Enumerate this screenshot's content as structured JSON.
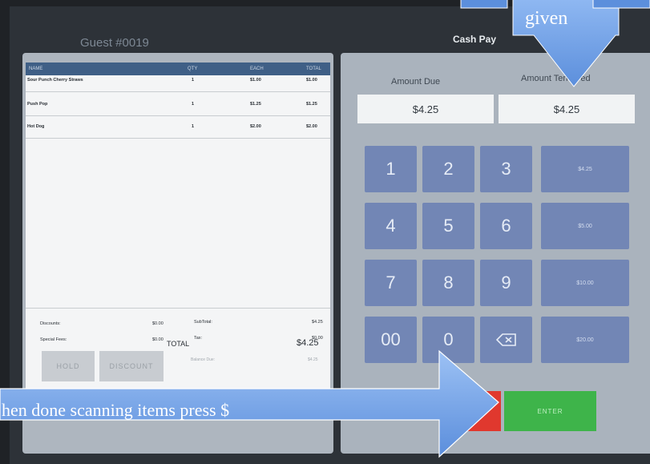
{
  "header": {
    "guest_label": "Guest #0019",
    "screen_title": "Cash Pay"
  },
  "receipt": {
    "columns": [
      "NAME",
      "QTY",
      "EACH",
      "TOTAL"
    ],
    "items": [
      {
        "name": "Sour Punch Cherry Straws",
        "qty": "1",
        "each": "$1.00",
        "total": "$1.00"
      },
      {
        "name": "Push Pop",
        "qty": "1",
        "each": "$1.25",
        "total": "$1.25"
      },
      {
        "name": "Hot Dog",
        "qty": "1",
        "each": "$2.00",
        "total": "$2.00"
      }
    ],
    "discounts_label": "Discounts:",
    "discounts_value": "$0.00",
    "special_fees_label": "Special Fees:",
    "special_fees_value": "$0.00",
    "subtotal_label": "SubTotal:",
    "subtotal_value": "$4.25",
    "tax_label": "Tax:",
    "tax_value": "$0.00",
    "total_label": "TOTAL",
    "total_value": "$4.25",
    "balance_label": "Balance Due:",
    "balance_value": "$4.25",
    "hold_label": "HOLD",
    "discount_label": "DISCOUNT"
  },
  "payment": {
    "amount_due_label": "Amount Due",
    "amount_due_value": "$4.25",
    "amount_tendered_label": "Amount Tendered",
    "amount_tendered_value": "$4.25",
    "keys": [
      "1",
      "2",
      "3",
      "4",
      "5",
      "6",
      "7",
      "8",
      "9",
      "00",
      "0"
    ],
    "backspace_icon": "backspace-icon",
    "quick_amounts": [
      "$4.25",
      "$5.00",
      "$10.00",
      "$20.00"
    ],
    "enter_label": "ENTER"
  },
  "callouts": {
    "top_text": "given",
    "bottom_text": "hen done scanning items press $"
  },
  "colors": {
    "keypad": "#7286b5",
    "enter": "#3eb44a",
    "cancel": "#e0382e",
    "callout": "#6f9ee6"
  }
}
